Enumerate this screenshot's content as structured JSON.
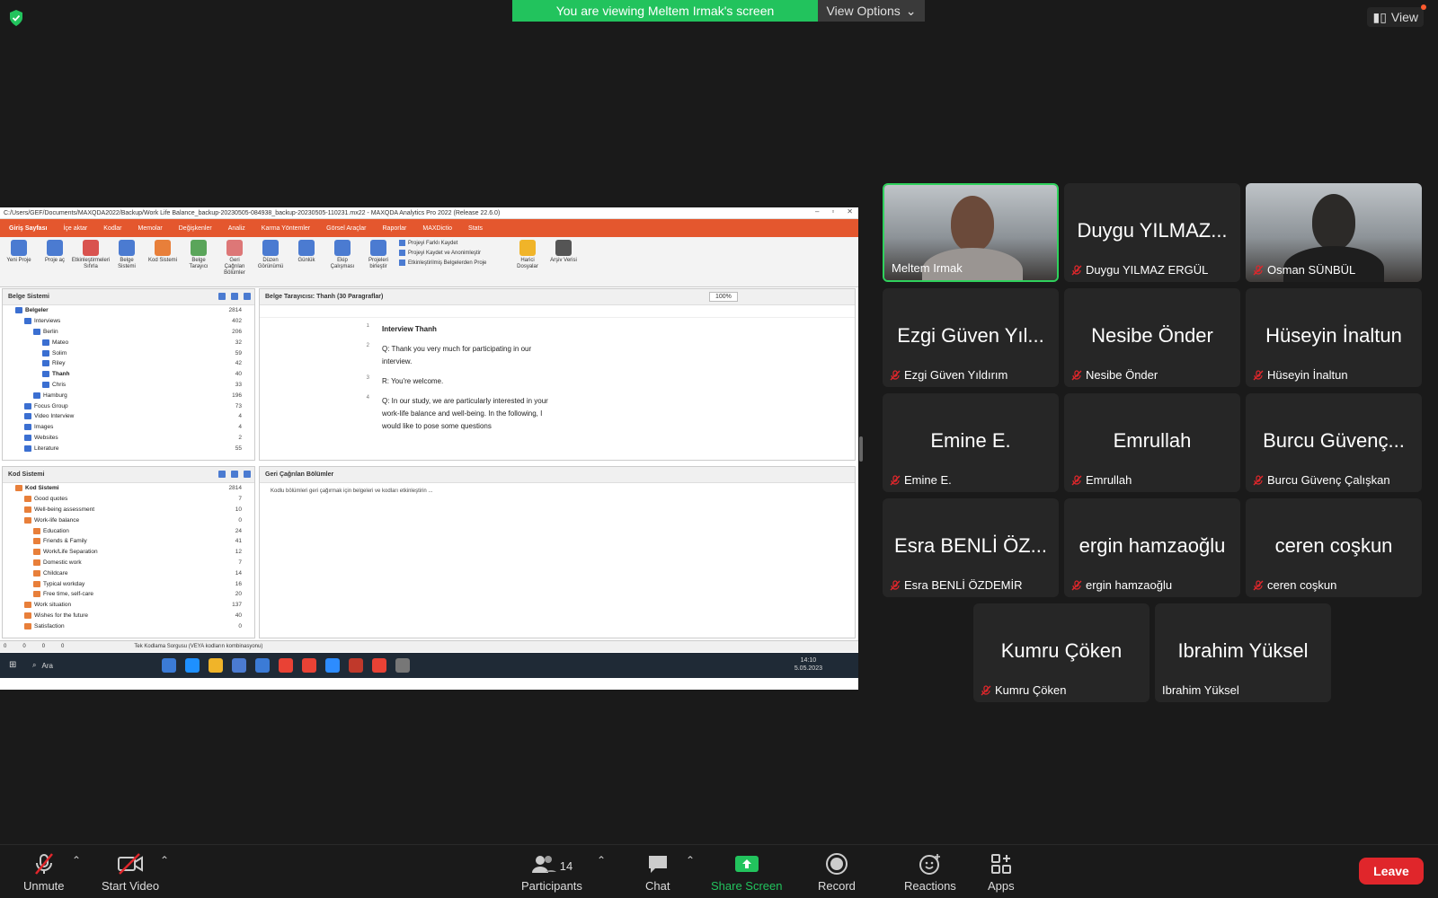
{
  "topbar": {
    "banner_text": "You are viewing Meltem Irmak's screen",
    "view_options": "View Options",
    "view": "View"
  },
  "maxqda": {
    "title": "C:/Users/GEF/Documents/MAXQDA2022/Backup/Work Life Balance_backup-20230505-084938_backup-20230505-110231.mx22 - MAXQDA Analytics Pro 2022 (Release 22.6.0)",
    "menu": [
      "Giriş Sayfası",
      "İçe aktar",
      "Kodlar",
      "Memolar",
      "Değişkenler",
      "Analiz",
      "Karma Yöntemler",
      "Görsel Araçlar",
      "Raporlar",
      "MAXDictio",
      "Stats"
    ],
    "ribbon": [
      {
        "label": "Yeni Proje",
        "color": "#4b7bd1"
      },
      {
        "label": "Proje aç",
        "color": "#4b7bd1"
      },
      {
        "label": "Etkinleştirmeleri Sıfırla",
        "color": "#d9534f"
      },
      {
        "label": "Belge Sistemi",
        "color": "#4b7bd1"
      },
      {
        "label": "Kod Sistemi",
        "color": "#e87f3a"
      },
      {
        "label": "Belge Tarayıcı",
        "color": "#5aa55a"
      },
      {
        "label": "Geri Çağrılan Bölümler",
        "color": "#d77"
      },
      {
        "label": "Düzen Görünümü",
        "color": "#4b7bd1"
      },
      {
        "label": "Günlük",
        "color": "#4b7bd1"
      },
      {
        "label": "Ekip Çalışması",
        "color": "#4b7bd1"
      },
      {
        "label": "Projeleri birleştir",
        "color": "#4b7bd1"
      }
    ],
    "ribbon_list": [
      "Projeyi Farklı Kaydet",
      "Projeyi Kaydet ve Anonimleştir",
      "Etkinleştirilmiş Belgelerden Proje"
    ],
    "ribbon_tail": [
      {
        "label": "Harici Dosyalar",
        "color": "#f0b429"
      },
      {
        "label": "Arşiv Verisi",
        "color": "#555"
      }
    ],
    "doc_system": {
      "title": "Belge Sistemi",
      "rows": [
        {
          "label": "Belgeler",
          "count": "2814",
          "indent": 1,
          "bold": true
        },
        {
          "label": "Interviews",
          "count": "402",
          "indent": 2
        },
        {
          "label": "Berlin",
          "count": "206",
          "indent": 3
        },
        {
          "label": "Mateo",
          "count": "32",
          "indent": 4
        },
        {
          "label": "Solim",
          "count": "59",
          "indent": 4
        },
        {
          "label": "Riley",
          "count": "42",
          "indent": 4
        },
        {
          "label": "Thanh",
          "count": "40",
          "indent": 4,
          "bold": true
        },
        {
          "label": "Chris",
          "count": "33",
          "indent": 4
        },
        {
          "label": "Hamburg",
          "count": "196",
          "indent": 3
        },
        {
          "label": "Focus Group",
          "count": "73",
          "indent": 2
        },
        {
          "label": "Video Interview",
          "count": "4",
          "indent": 2
        },
        {
          "label": "Images",
          "count": "4",
          "indent": 2
        },
        {
          "label": "Websites",
          "count": "2",
          "indent": 2
        },
        {
          "label": "Literature",
          "count": "55",
          "indent": 2
        }
      ]
    },
    "doc_browser": {
      "title": "Belge Tarayıcısı: Thanh   (30 Paragraflar)",
      "zoom": "100%",
      "lines": [
        {
          "n": "1",
          "text": "Interview Thanh"
        },
        {
          "n": "2",
          "text": "Q: Thank you very much for participating in our interview."
        },
        {
          "n": "3",
          "text": "R: You're welcome."
        },
        {
          "n": "4",
          "text": "Q:  In our study, we are particularly interested in your work-life balance and well-being. In the following, I would like to pose some questions"
        }
      ]
    },
    "code_system": {
      "title": "Kod Sistemi",
      "rows": [
        {
          "label": "Kod Sistemi",
          "count": "2814",
          "indent": 1,
          "bold": true
        },
        {
          "label": "Good quotes",
          "count": "7",
          "indent": 2
        },
        {
          "label": "Well-being assessment",
          "count": "10",
          "indent": 2
        },
        {
          "label": "Work-life balance",
          "count": "0",
          "indent": 2
        },
        {
          "label": "Education",
          "count": "24",
          "indent": 3
        },
        {
          "label": "Friends & Family",
          "count": "41",
          "indent": 3
        },
        {
          "label": "Work/Life Separation",
          "count": "12",
          "indent": 3
        },
        {
          "label": "Domestic work",
          "count": "7",
          "indent": 3
        },
        {
          "label": "Childcare",
          "count": "14",
          "indent": 3
        },
        {
          "label": "Typical workday",
          "count": "16",
          "indent": 3
        },
        {
          "label": "Free time, self-care",
          "count": "20",
          "indent": 3
        },
        {
          "label": "Work situation",
          "count": "137",
          "indent": 2
        },
        {
          "label": "Wishes for the future",
          "count": "40",
          "indent": 2
        },
        {
          "label": "Satisfaction",
          "count": "0",
          "indent": 2
        }
      ]
    },
    "retrieved": {
      "title": "Geri Çağrılan Bölümler",
      "hint": "Kodlu bölümleri geri çağırmak için belgeleri ve kodları etkinleştirin ..."
    },
    "status": {
      "counts": [
        "0",
        "0",
        "0",
        "0"
      ],
      "query": "Tek Kodlama Sorgusu (VEYA kodların kombinasyonu)"
    },
    "taskbar": {
      "search": "Ara",
      "time": "14:10",
      "date": "5.05.2023",
      "apps": [
        "#3b7bd6",
        "#1e90ff",
        "#f0b429",
        "#4b7bd1",
        "#3b7bd6",
        "#e94235",
        "#e94235",
        "#2d8cff",
        "#c0392b",
        "#e94235",
        "#777"
      ]
    }
  },
  "participants_grid": [
    {
      "big": "",
      "name": "Meltem Irmak",
      "muted": false,
      "video": true,
      "active": true,
      "col": 0,
      "row": 0
    },
    {
      "big": "Duygu YILMAZ...",
      "name": "Duygu YILMAZ ERGÜL",
      "muted": true,
      "col": 1,
      "row": 0
    },
    {
      "big": "",
      "name": "Osman SÜNBÜL",
      "muted": true,
      "video": true,
      "col": 2,
      "row": 0
    },
    {
      "big": "Ezgi Güven Yıl...",
      "name": "Ezgi Güven Yıldırım",
      "muted": true,
      "col": 0,
      "row": 1
    },
    {
      "big": "Nesibe Önder",
      "name": "Nesibe Önder",
      "muted": true,
      "col": 1,
      "row": 1
    },
    {
      "big": "Hüseyin İnaltun",
      "name": "Hüseyin İnaltun",
      "muted": true,
      "col": 2,
      "row": 1
    },
    {
      "big": "Emine E.",
      "name": "Emine E.",
      "muted": true,
      "col": 0,
      "row": 2
    },
    {
      "big": "Emrullah",
      "name": "Emrullah",
      "muted": true,
      "col": 1,
      "row": 2
    },
    {
      "big": "Burcu Güvenç...",
      "name": "Burcu Güvenç Çalışkan",
      "muted": true,
      "col": 2,
      "row": 2
    },
    {
      "big": "Esra BENLİ ÖZ...",
      "name": "Esra BENLİ ÖZDEMİR",
      "muted": true,
      "col": 0,
      "row": 3
    },
    {
      "big": "ergin hamzaoğlu",
      "name": "ergin hamzaoğlu",
      "muted": true,
      "col": 1,
      "row": 3
    },
    {
      "big": "ceren coşkun",
      "name": "ceren coşkun",
      "muted": true,
      "col": 2,
      "row": 3
    },
    {
      "big": "Kumru Çöken",
      "name": "Kumru Çöken",
      "muted": true,
      "col": 0.5,
      "row": 4
    },
    {
      "big": "Ibrahim Yüksel",
      "name": "Ibrahim Yüksel",
      "muted": false,
      "col": 1.5,
      "row": 4
    }
  ],
  "toolbar": {
    "unmute": "Unmute",
    "start_video": "Start Video",
    "participants": "Participants",
    "participants_count": "14",
    "chat": "Chat",
    "share_screen": "Share Screen",
    "record": "Record",
    "reactions": "Reactions",
    "apps": "Apps",
    "leave": "Leave"
  },
  "colors": {
    "banner": "#22c35d",
    "active_border": "#2fd15c",
    "leave": "#e0262b",
    "mute": "#e0262b",
    "share": "#2fd15c"
  }
}
